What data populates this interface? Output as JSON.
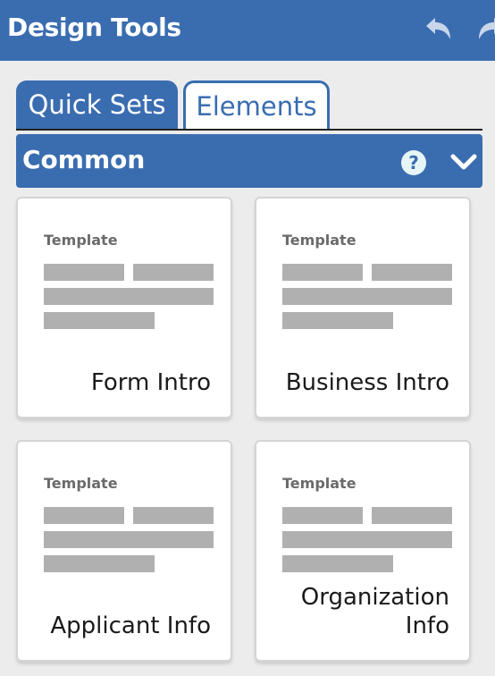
{
  "header": {
    "title": "Design Tools",
    "undo_icon": "undo-icon",
    "redo_icon": "redo-icon"
  },
  "tabs": [
    {
      "label": "Quick Sets",
      "active": false
    },
    {
      "label": "Elements",
      "active": true
    }
  ],
  "section": {
    "label": "Common",
    "help_glyph": "?",
    "help_icon": "help-icon",
    "toggle_icon": "chevron-down-icon"
  },
  "cards": [
    {
      "template_label": "Template",
      "name": "Form Intro"
    },
    {
      "template_label": "Template",
      "name": "Business Intro"
    },
    {
      "template_label": "Template",
      "name": "Applicant Info"
    },
    {
      "template_label": "Template",
      "name": "Organization Info"
    }
  ],
  "colors": {
    "accent": "#3a6db0",
    "background": "#ececec",
    "placeholder_bar": "#b0b0b0"
  }
}
